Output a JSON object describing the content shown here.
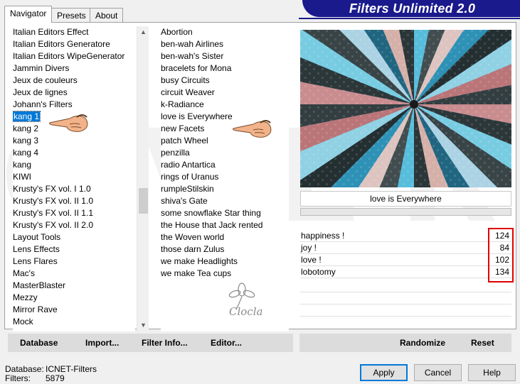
{
  "header": {
    "title": "Filters Unlimited 2.0"
  },
  "tabs": [
    {
      "label": "Navigator",
      "active": true
    },
    {
      "label": "Presets",
      "active": false
    },
    {
      "label": "About",
      "active": false
    }
  ],
  "categories": {
    "items": [
      "Italian Editors Effect",
      "Italian Editors Generatore",
      "Italian Editors WipeGenerator",
      "Jammin Divers",
      "Jeux de couleurs",
      "Jeux de lignes",
      "Johann's Filters",
      "kang 1",
      "kang 2",
      "kang 3",
      "kang 4",
      "kang",
      "KIWI",
      "Krusty's FX vol. I 1.0",
      "Krusty's FX vol. II 1.0",
      "Krusty's FX vol. II 1.1",
      "Krusty's FX vol. II 2.0",
      "Layout Tools",
      "Lens Effects",
      "Lens Flares",
      "Mac's",
      "MasterBlaster",
      "Mezzy",
      "Mirror Rave",
      "Mock"
    ],
    "selected": "kang 1"
  },
  "filters": {
    "items": [
      "Abortion",
      "ben-wah Airlines",
      "ben-wah's Sister",
      "bracelets for Mona",
      "busy Circuits",
      "circuit Weaver",
      "k-Radiance",
      "love is Everywhere",
      "new Facets",
      "patch Wheel",
      "penzilla",
      "radio Antartica",
      "rings of Uranus",
      "rumpleStilskin",
      "shiva's Gate",
      "some snowflake Star thing",
      "the House that Jack rented",
      "the Woven world",
      "those darn Zulus",
      "we make Headlights",
      "we make Tea cups"
    ],
    "selected": "love is Everywhere"
  },
  "preview": {
    "filter_name": "love is Everywhere",
    "progress": 0
  },
  "parameters": [
    {
      "label": "happiness !",
      "value": "124"
    },
    {
      "label": "joy !",
      "value": "84"
    },
    {
      "label": "love !",
      "value": "102"
    },
    {
      "label": "lobotomy",
      "value": "134"
    }
  ],
  "bottom_left_buttons": {
    "database": "Database",
    "import": "Import...",
    "filter_info": "Filter Info...",
    "editor": "Editor..."
  },
  "bottom_right_buttons": {
    "randomize": "Randomize",
    "reset": "Reset"
  },
  "status": {
    "database_label": "Database:",
    "database_value": "ICNET-Filters",
    "filters_label": "Filters:",
    "filters_value": "5879"
  },
  "dialog_buttons": {
    "apply": "Apply",
    "cancel": "Cancel",
    "help": "Help"
  },
  "watermark_signature": "Clocla",
  "colors": {
    "banner": "#1a1a8c",
    "selection": "#0078d7",
    "highlight_box": "#e00000"
  }
}
